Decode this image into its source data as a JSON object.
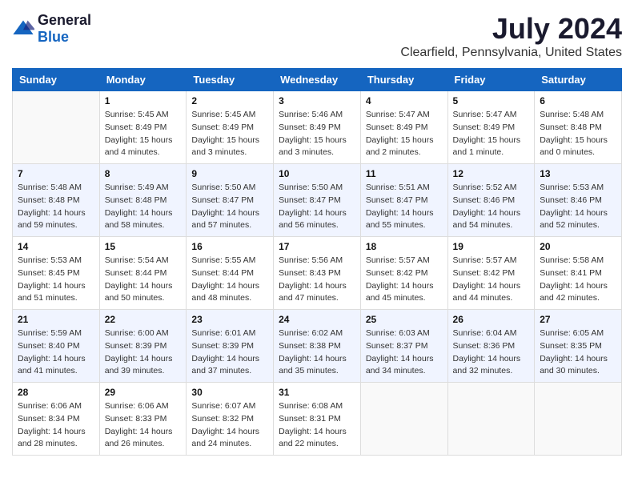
{
  "logo": {
    "general": "General",
    "blue": "Blue"
  },
  "title": "July 2024",
  "subtitle": "Clearfield, Pennsylvania, United States",
  "headers": [
    "Sunday",
    "Monday",
    "Tuesday",
    "Wednesday",
    "Thursday",
    "Friday",
    "Saturday"
  ],
  "weeks": [
    [
      {
        "day": "",
        "info": ""
      },
      {
        "day": "1",
        "info": "Sunrise: 5:45 AM\nSunset: 8:49 PM\nDaylight: 15 hours\nand 4 minutes."
      },
      {
        "day": "2",
        "info": "Sunrise: 5:45 AM\nSunset: 8:49 PM\nDaylight: 15 hours\nand 3 minutes."
      },
      {
        "day": "3",
        "info": "Sunrise: 5:46 AM\nSunset: 8:49 PM\nDaylight: 15 hours\nand 3 minutes."
      },
      {
        "day": "4",
        "info": "Sunrise: 5:47 AM\nSunset: 8:49 PM\nDaylight: 15 hours\nand 2 minutes."
      },
      {
        "day": "5",
        "info": "Sunrise: 5:47 AM\nSunset: 8:49 PM\nDaylight: 15 hours\nand 1 minute."
      },
      {
        "day": "6",
        "info": "Sunrise: 5:48 AM\nSunset: 8:48 PM\nDaylight: 15 hours\nand 0 minutes."
      }
    ],
    [
      {
        "day": "7",
        "info": "Sunrise: 5:48 AM\nSunset: 8:48 PM\nDaylight: 14 hours\nand 59 minutes."
      },
      {
        "day": "8",
        "info": "Sunrise: 5:49 AM\nSunset: 8:48 PM\nDaylight: 14 hours\nand 58 minutes."
      },
      {
        "day": "9",
        "info": "Sunrise: 5:50 AM\nSunset: 8:47 PM\nDaylight: 14 hours\nand 57 minutes."
      },
      {
        "day": "10",
        "info": "Sunrise: 5:50 AM\nSunset: 8:47 PM\nDaylight: 14 hours\nand 56 minutes."
      },
      {
        "day": "11",
        "info": "Sunrise: 5:51 AM\nSunset: 8:47 PM\nDaylight: 14 hours\nand 55 minutes."
      },
      {
        "day": "12",
        "info": "Sunrise: 5:52 AM\nSunset: 8:46 PM\nDaylight: 14 hours\nand 54 minutes."
      },
      {
        "day": "13",
        "info": "Sunrise: 5:53 AM\nSunset: 8:46 PM\nDaylight: 14 hours\nand 52 minutes."
      }
    ],
    [
      {
        "day": "14",
        "info": "Sunrise: 5:53 AM\nSunset: 8:45 PM\nDaylight: 14 hours\nand 51 minutes."
      },
      {
        "day": "15",
        "info": "Sunrise: 5:54 AM\nSunset: 8:44 PM\nDaylight: 14 hours\nand 50 minutes."
      },
      {
        "day": "16",
        "info": "Sunrise: 5:55 AM\nSunset: 8:44 PM\nDaylight: 14 hours\nand 48 minutes."
      },
      {
        "day": "17",
        "info": "Sunrise: 5:56 AM\nSunset: 8:43 PM\nDaylight: 14 hours\nand 47 minutes."
      },
      {
        "day": "18",
        "info": "Sunrise: 5:57 AM\nSunset: 8:42 PM\nDaylight: 14 hours\nand 45 minutes."
      },
      {
        "day": "19",
        "info": "Sunrise: 5:57 AM\nSunset: 8:42 PM\nDaylight: 14 hours\nand 44 minutes."
      },
      {
        "day": "20",
        "info": "Sunrise: 5:58 AM\nSunset: 8:41 PM\nDaylight: 14 hours\nand 42 minutes."
      }
    ],
    [
      {
        "day": "21",
        "info": "Sunrise: 5:59 AM\nSunset: 8:40 PM\nDaylight: 14 hours\nand 41 minutes."
      },
      {
        "day": "22",
        "info": "Sunrise: 6:00 AM\nSunset: 8:39 PM\nDaylight: 14 hours\nand 39 minutes."
      },
      {
        "day": "23",
        "info": "Sunrise: 6:01 AM\nSunset: 8:39 PM\nDaylight: 14 hours\nand 37 minutes."
      },
      {
        "day": "24",
        "info": "Sunrise: 6:02 AM\nSunset: 8:38 PM\nDaylight: 14 hours\nand 35 minutes."
      },
      {
        "day": "25",
        "info": "Sunrise: 6:03 AM\nSunset: 8:37 PM\nDaylight: 14 hours\nand 34 minutes."
      },
      {
        "day": "26",
        "info": "Sunrise: 6:04 AM\nSunset: 8:36 PM\nDaylight: 14 hours\nand 32 minutes."
      },
      {
        "day": "27",
        "info": "Sunrise: 6:05 AM\nSunset: 8:35 PM\nDaylight: 14 hours\nand 30 minutes."
      }
    ],
    [
      {
        "day": "28",
        "info": "Sunrise: 6:06 AM\nSunset: 8:34 PM\nDaylight: 14 hours\nand 28 minutes."
      },
      {
        "day": "29",
        "info": "Sunrise: 6:06 AM\nSunset: 8:33 PM\nDaylight: 14 hours\nand 26 minutes."
      },
      {
        "day": "30",
        "info": "Sunrise: 6:07 AM\nSunset: 8:32 PM\nDaylight: 14 hours\nand 24 minutes."
      },
      {
        "day": "31",
        "info": "Sunrise: 6:08 AM\nSunset: 8:31 PM\nDaylight: 14 hours\nand 22 minutes."
      },
      {
        "day": "",
        "info": ""
      },
      {
        "day": "",
        "info": ""
      },
      {
        "day": "",
        "info": ""
      }
    ]
  ]
}
